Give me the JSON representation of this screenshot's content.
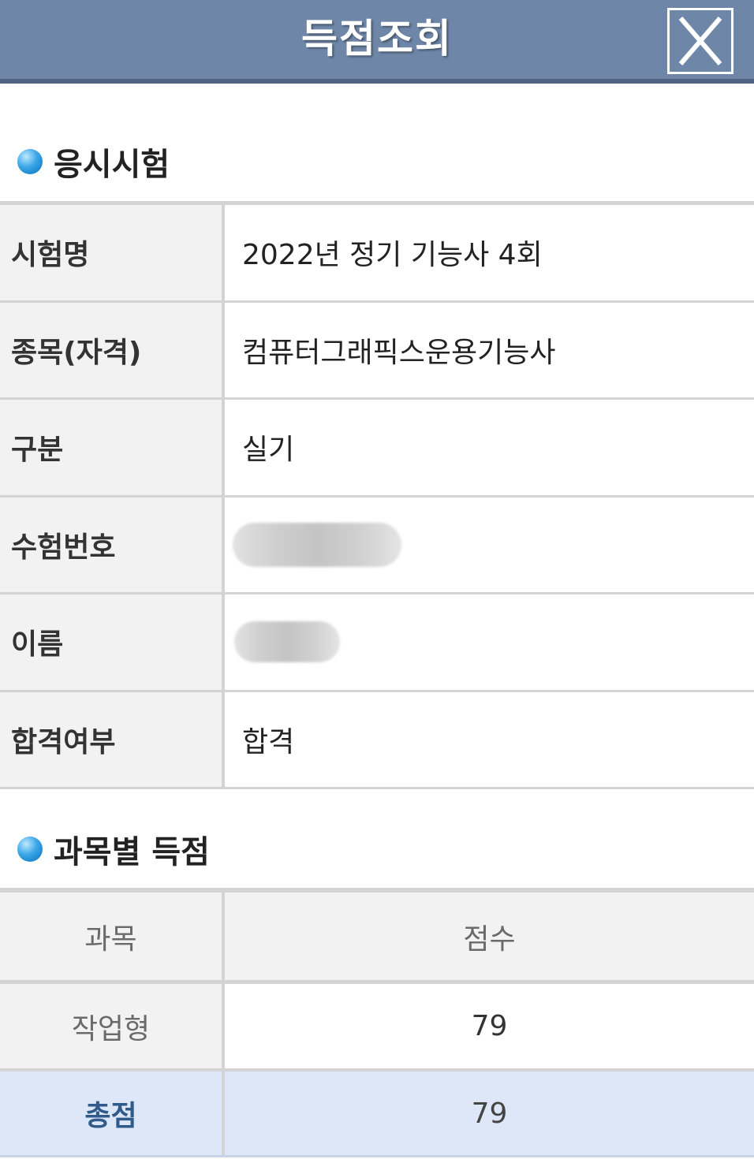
{
  "header": {
    "title": "득점조회",
    "close_icon": "close-icon"
  },
  "exam_section": {
    "title": "응시시험",
    "bullet_icon": "blue-dot-icon",
    "rows": [
      {
        "label": "시험명",
        "value": "2022년 정기 기능사 4회"
      },
      {
        "label": "종목(자격)",
        "value": "컴퓨터그래픽스운용기능사"
      },
      {
        "label": "구분",
        "value": "실기"
      },
      {
        "label": "수험번호",
        "value": ""
      },
      {
        "label": "이름",
        "value": ""
      },
      {
        "label": "합격여부",
        "value": "합격"
      }
    ]
  },
  "score_section": {
    "title": "과목별 득점",
    "bullet_icon": "blue-dot-icon",
    "headers": [
      "과목",
      "점수"
    ],
    "rows": [
      {
        "subject": "작업형",
        "score": "79"
      }
    ],
    "total": {
      "label": "총점",
      "score": "79"
    }
  },
  "colors": {
    "header_bg": "#6e86a7",
    "total_row_bg": "#dde7f7",
    "total_label": "#2f5a8a"
  }
}
